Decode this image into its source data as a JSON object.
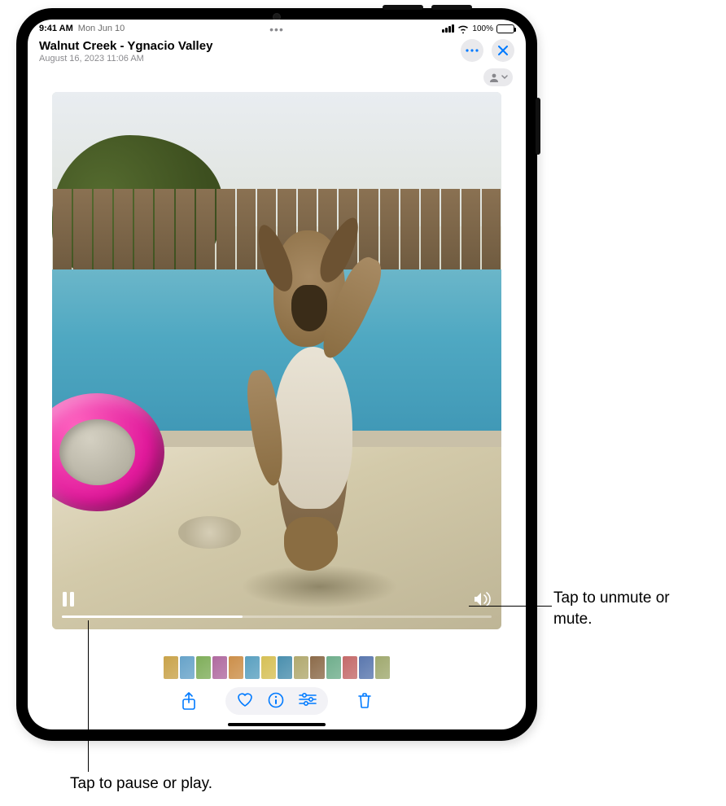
{
  "status": {
    "time": "9:41 AM",
    "date": "Mon Jun 10",
    "battery_text": "100%"
  },
  "header": {
    "title": "Walnut Creek - Ygnacio Valley",
    "subtitle": "August 16, 2023  11:06 AM"
  },
  "icons": {
    "more": "more-icon",
    "close": "close-icon",
    "people": "people-icon",
    "pause": "pause-icon",
    "volume": "volume-icon",
    "share": "share-icon",
    "heart": "heart-icon",
    "info": "info-icon",
    "adjust": "adjust-icon",
    "trash": "trash-icon"
  },
  "video": {
    "progress_pct": 42
  },
  "filmstrip": {
    "thumbs": [
      "#c9a34a",
      "#67a3c9",
      "#7fae5a",
      "#b06aa0",
      "#cc8f4a",
      "#5aa0c0",
      "#d6c056",
      "#4a8fae",
      "#b1a96f",
      "#8c6b4a",
      "#6fae8c",
      "#c46a6a",
      "#5a77ae",
      "#a0a96f"
    ]
  },
  "callouts": {
    "mute": "Tap to unmute or mute.",
    "play": "Tap to pause or play."
  }
}
